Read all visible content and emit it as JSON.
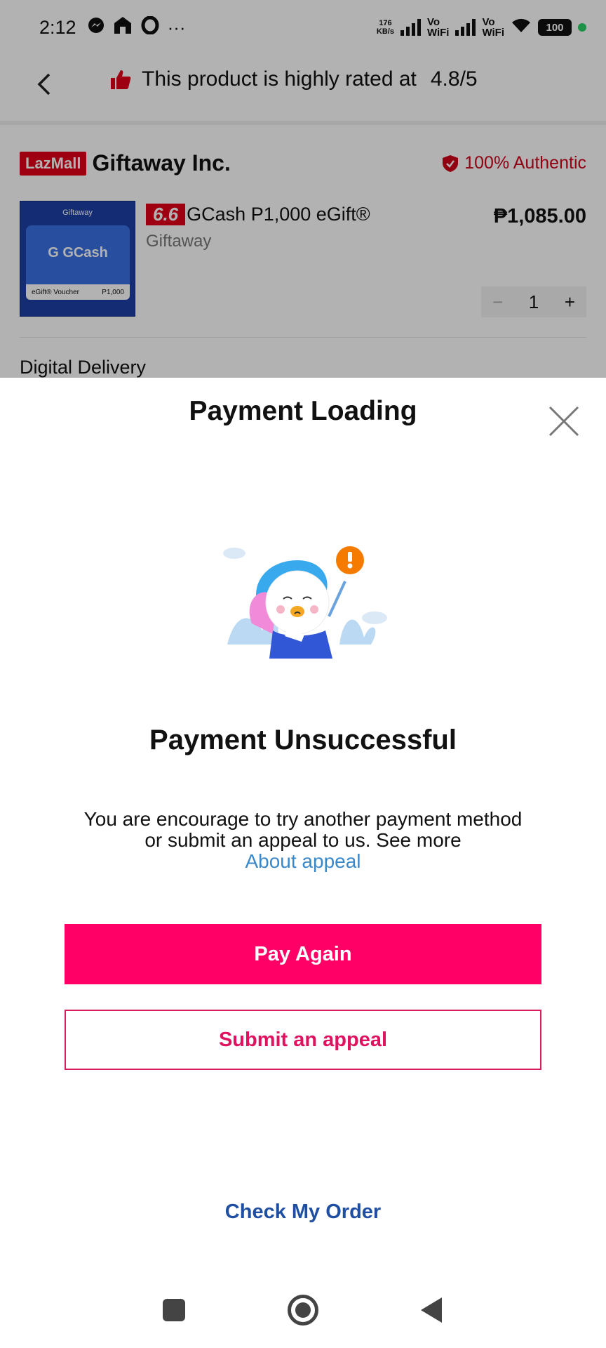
{
  "status_bar": {
    "time": "2:12",
    "net_speed_top": "176",
    "net_speed_bottom": "KB/s",
    "vo_top": "Vo",
    "wifi_label": "WiFi",
    "battery": "100",
    "more": "···"
  },
  "header": {
    "rated_text": "This product is highly rated at",
    "rating": "4.8/5"
  },
  "shop": {
    "badge": "LazMall",
    "name": "Giftaway Inc.",
    "authentic": "100% Authentic"
  },
  "product": {
    "promo_badge": "6.6",
    "title": "GCash P1,000 eGift®",
    "seller": "Giftaway",
    "price": "₱1,085.00",
    "quantity": "1",
    "image_brand": "Giftaway",
    "image_logo": "G GCash",
    "image_voucher": "eGift® Voucher",
    "image_amount": "P1,000"
  },
  "delivery_label": "Digital Delivery",
  "sheet": {
    "title": "Payment Loading",
    "fail_title": "Payment Unsuccessful",
    "fail_desc": "You are encourage to try another payment method or submit an appeal to us. See more",
    "appeal_link": "About appeal",
    "pay_again": "Pay Again",
    "submit_appeal": "Submit an appeal",
    "check_order": "Check My Order"
  },
  "colors": {
    "primary": "#ff0066",
    "link": "#3b88c9",
    "check_order": "#1f4fa3",
    "authentic": "#d0021b"
  }
}
